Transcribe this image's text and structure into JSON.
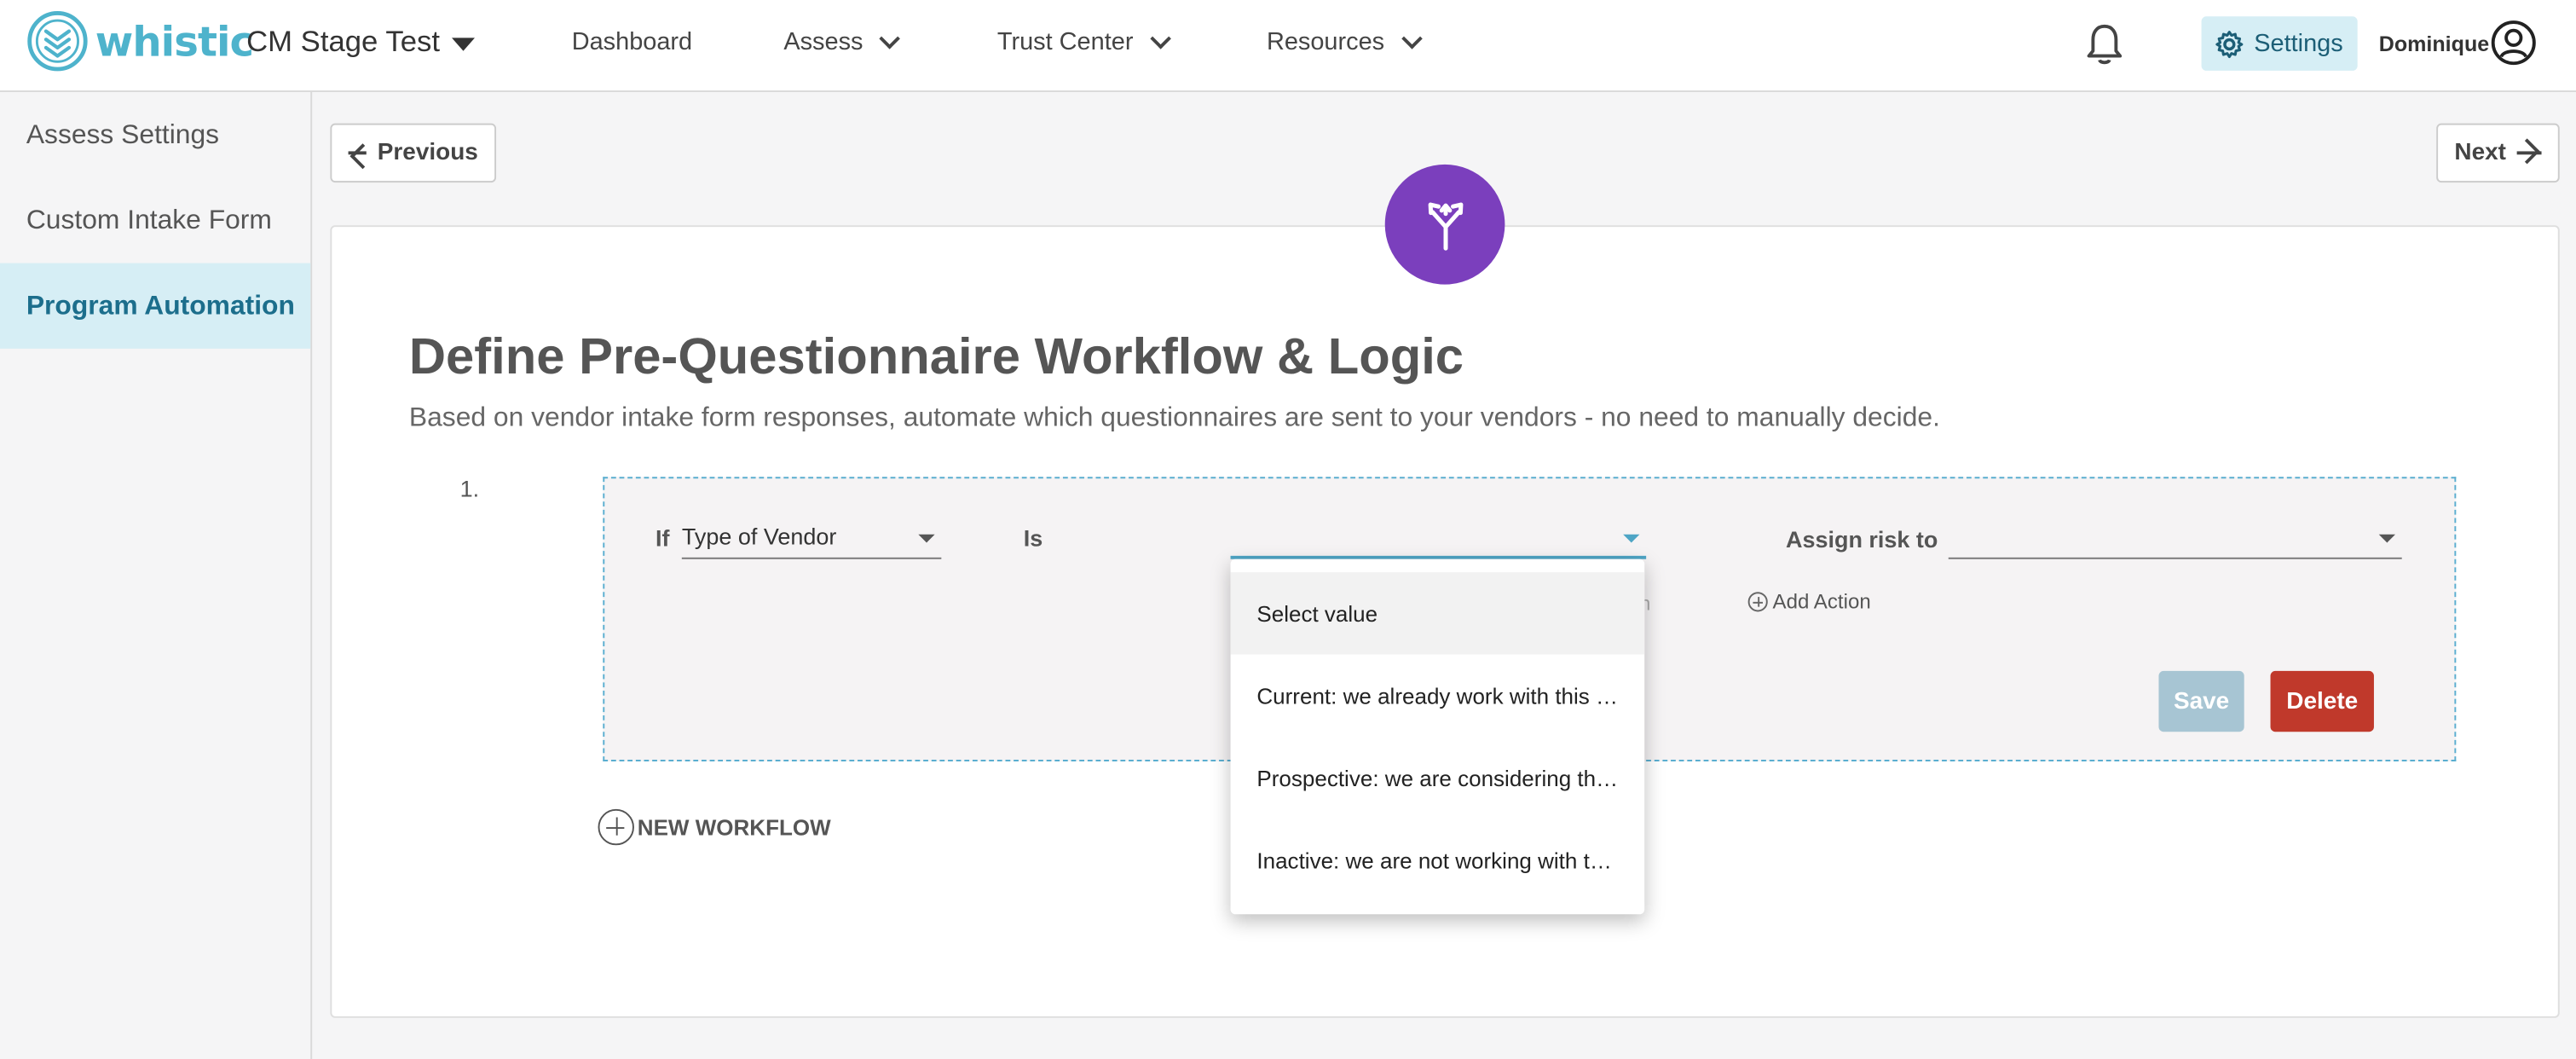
{
  "header": {
    "logo_text": "whistic",
    "org_name": "CM Stage Test",
    "nav": [
      {
        "label": "Dashboard"
      },
      {
        "label": "Assess"
      },
      {
        "label": "Trust Center"
      },
      {
        "label": "Resources"
      }
    ],
    "settings_label": "Settings",
    "user_name": "Dominique"
  },
  "sidebar": {
    "items": [
      {
        "label": "Assess Settings"
      },
      {
        "label": "Custom Intake Form"
      },
      {
        "label": "Program Automation"
      }
    ]
  },
  "pager": {
    "previous_label": "Previous",
    "next_label": "Next"
  },
  "main": {
    "title": "Define Pre-Questionnaire Workflow & Logic",
    "subtitle": "Based on vendor intake form responses, automate which questionnaires are sent to your vendors - no need to manually decide.",
    "workflow_number": "1."
  },
  "workflow": {
    "if_label": "If",
    "field_value": "Type of Vendor",
    "is_label": "Is",
    "value_selected": "",
    "assign_label": "Assign risk to",
    "assign_value": "",
    "partial_text": "n",
    "add_action_label": "Add Action",
    "save_label": "Save",
    "delete_label": "Delete",
    "new_workflow_label": "NEW WORKFLOW"
  },
  "dropdown": {
    "options": [
      {
        "label": "Select value"
      },
      {
        "label": "Current: we already work with this vendor"
      },
      {
        "label": "Prospective: we are considering this vendor"
      },
      {
        "label": "Inactive: we are not working with this vendor"
      }
    ]
  },
  "colors": {
    "brand": "#4eb3cc",
    "active_bg": "#d6eef5",
    "workflow_badge": "#7b3fbd",
    "delete": "#c0392b",
    "save_disabled": "#a7c5d3"
  }
}
